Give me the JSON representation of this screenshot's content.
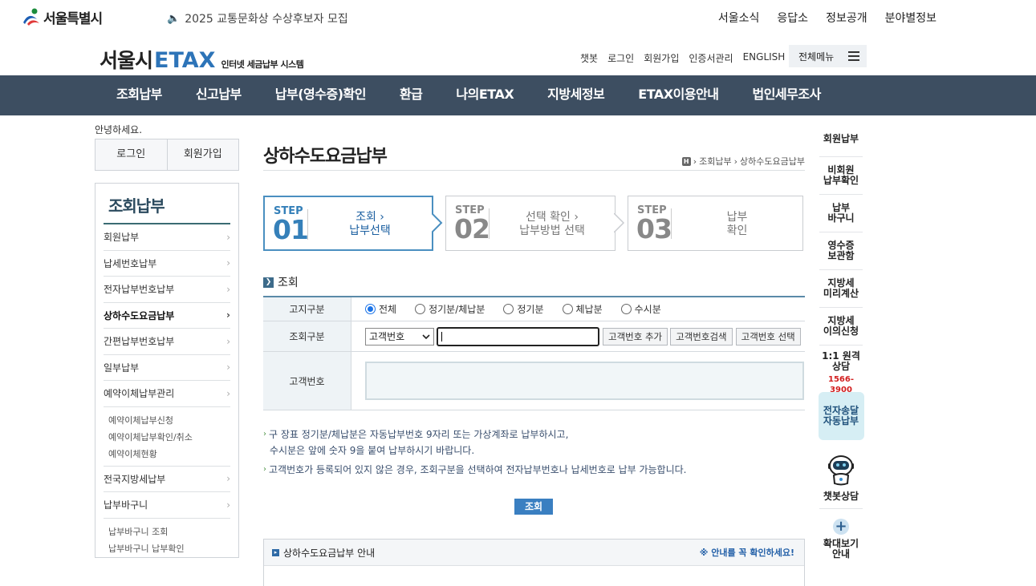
{
  "topbar": {
    "logo_text": "서울특별시",
    "notice": "2025 교통문화상 수상후보자 모집",
    "links": [
      "서울소식",
      "응답소",
      "정보공개",
      "분야별정보"
    ]
  },
  "header": {
    "brand_kor": "서울시",
    "brand_etax": "ETAX",
    "brand_sub": "인터넷 세금납부 시스템",
    "util_links": [
      "챗봇",
      "로그인",
      "회원가입",
      "인증서관리",
      "ENGLISH"
    ],
    "all_menu": "전체메뉴"
  },
  "gnb": [
    "조회납부",
    "신고납부",
    "납부(영수증)확인",
    "환급",
    "나의ETAX",
    "지방세정보",
    "ETAX이용안내",
    "법인세무조사"
  ],
  "left": {
    "greeting": "안녕하세요.",
    "login": "로그인",
    "join": "회원가입",
    "lnb_title": "조회납부",
    "items": [
      "회원납부",
      "납세번호납부",
      "전자납부번호납부",
      "상하수도요금납부",
      "간편납부번호납부",
      "일부납부",
      "예약이체납부관리"
    ],
    "sub1": [
      "예약이체납부신청",
      "예약이체납부확인/취소",
      "예약이체현황"
    ],
    "items2": [
      "전국지방세납부",
      "납부바구니"
    ],
    "sub2": [
      "납부바구니 조회",
      "납부바구니 납부확인"
    ]
  },
  "main": {
    "title": "상하수도요금납부",
    "breadcrumb_home": "H",
    "breadcrumb": [
      "조회납부",
      "상하수도요금납부"
    ],
    "steps": [
      {
        "label": "STEP",
        "num": "01",
        "line1": "조회",
        "line2": "납부선택",
        "active": true
      },
      {
        "label": "STEP",
        "num": "02",
        "line1": "선택 확인",
        "line2": "납부방법 선택",
        "active": false
      },
      {
        "label": "STEP",
        "num": "03",
        "line1": "납부",
        "line2": "확인",
        "active": false
      }
    ],
    "section_title": "조회",
    "form": {
      "notice_type_label": "고지구분",
      "radios": [
        "전체",
        "정기분/체납분",
        "정기분",
        "체납분",
        "수시분"
      ],
      "radio_selected": "전체",
      "search_type_label": "조회구분",
      "select_value": "고객번호",
      "input_value": "",
      "buttons": [
        "고객번호 추가",
        "고객번호검색",
        "고객번호 선택"
      ],
      "customer_no_label": "고객번호"
    },
    "notes": {
      "n1_line1": "구 장표 정기분/체납분은 자동납부번호 9자리 또는 가상계좌로 납부하시고,",
      "n1_line2": "수시분은 앞에 숫자 9을 붙여 납부하시기 바랍니다.",
      "n2": "고객번호가 등록되어 있지 않은 경우, 조회구분을 선택하여 전자납부번호나 납세번호로 납부 가능합니다."
    },
    "query_button": "조회",
    "guide_title": "상하수도요금납부 안내",
    "guide_note": "※ 안내를 꼭 확인하세요!"
  },
  "quick": {
    "items": [
      "회원납부",
      "비회원\n납부확인",
      "납부\n바구니",
      "영수증\n보관함",
      "지방세\n미리계산",
      "지방세\n이의신청"
    ],
    "consult": "1:1 원격\n상담",
    "phone": "1566-3900",
    "ebill": "전자송달\n자동납부",
    "chatbot": "챗봇상담",
    "zoom": "확대보기\n안내"
  },
  "colors": {
    "gnb_bg": "#3d4e61",
    "brand_blue": "#2d74b8",
    "step_active": "#3580b9",
    "query_btn": "#3a7fc1",
    "phone_red": "#d21e1e"
  }
}
